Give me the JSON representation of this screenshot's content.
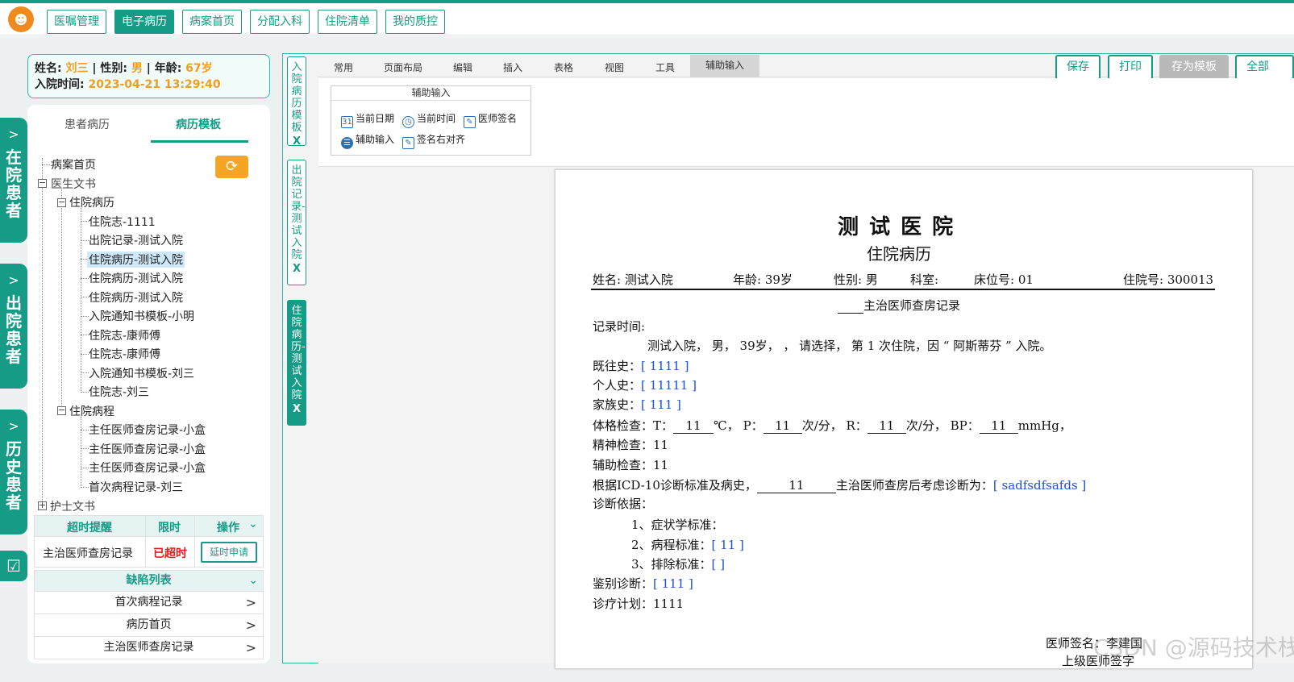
{
  "nav": {
    "tabs": [
      "医嘱管理",
      "电子病历",
      "病案首页",
      "分配入科",
      "住院清单",
      "我的质控"
    ]
  },
  "side": {
    "tabs": [
      "在院患者",
      "出院患者",
      "历史患者"
    ]
  },
  "patient": {
    "name_label": "姓名:",
    "name": "刘三",
    "gender_label": "| 性别:",
    "gender": "男",
    "age_label": "| 年龄:",
    "age": "67岁",
    "admit_label": "入院时间:",
    "admit_time": "2023-04-21 13:29:40"
  },
  "left_tabs": [
    "患者病历",
    "病历模板"
  ],
  "tree": [
    "病案首页",
    "医生文书",
    "住院病历",
    "住院志-1111",
    "出院记录-测试入院",
    "住院病历-测试入院",
    "住院病历-测试入院",
    "住院病历-测试入院",
    "入院通知书模板-小明",
    "住院志-康师傅",
    "住院志-康师傅",
    "入院通知书模板-刘三",
    "住院志-刘三",
    "住院病程",
    "主任医师查房记录-小盒",
    "主任医师查房记录-小盒",
    "主任医师查房记录-小盒",
    "首次病程记录-刘三",
    "护士文书"
  ],
  "alert": {
    "headers": [
      "超时提醒",
      "限时",
      "操作"
    ],
    "row": {
      "name": "主治医师查房记录",
      "status": "已超时",
      "action": "延时申请"
    }
  },
  "defects": {
    "title": "缺陷列表",
    "items": [
      "首次病程记录",
      "病历首页",
      "主治医师查房记录"
    ]
  },
  "vtabs": [
    {
      "label": "入院病历模板",
      "close": "X"
    },
    {
      "label": "出院记录-测试入院",
      "close": "X"
    },
    {
      "label": "住院病历-测试入院",
      "close": "X"
    }
  ],
  "ribbon": {
    "tabs": [
      "常用",
      "页面布局",
      "编辑",
      "插入",
      "表格",
      "视图",
      "工具",
      "辅助输入"
    ],
    "group_title": "辅助输入",
    "items": [
      "当前日期",
      "当前时间",
      "医师签名",
      "辅助输入",
      "签名右对齐"
    ],
    "actions": [
      "保存",
      "打印",
      "存为模板",
      "全部"
    ]
  },
  "document": {
    "hospital": "测 试 医 院",
    "subtitle": "住院病历",
    "name": "姓名: 测试入院",
    "age": "年龄: 39岁",
    "gender": "性别: 男",
    "dept": "科室:",
    "bed": "床位号: 01",
    "inpatient_no": "住院号: 300013",
    "record_title": "主治医师查房记录",
    "record_time": "记录时间:",
    "intro": "测试入院， 男， 39岁， ， 请选择， 第 1 次住院，因 “ 阿斯蒂芬 ” 入院。",
    "past_history_label": "既往史：",
    "past_history": "[ 1111 ]",
    "personal_history_label": "个人史：",
    "personal_history": "[ 11111 ]",
    "family_history_label": "家族史：",
    "family_history": "[ 111 ]",
    "exam_label": "体格检查：",
    "exam_t": "T：",
    "exam_t_val": "11",
    "exam_t_unit": "℃，  P：",
    "exam_p_val": "11",
    "exam_p_unit": "次/分，  R：",
    "exam_r_val": "11",
    "exam_r_unit": "次/分，  BP：",
    "exam_bp_val": "11",
    "exam_bp_unit": "mmHg，",
    "mental": "精神检查：11",
    "aux": "辅助检查：11",
    "basis_pre": "根据ICD-10诊断标准及病史，",
    "basis_val": "11",
    "basis_post": "主治医师查房后考虑诊断为：",
    "basis_diag": "[ sadfsdfsafds ]",
    "diag_basis": "诊断依据：",
    "crit1": "1、症状学标准：",
    "crit2_label": "2、病程标准：",
    "crit2": "[ 11 ]",
    "crit3_label": "3、排除标准：",
    "crit3": "[ ]",
    "differential_label": "鉴别诊断：",
    "differential": "[ 111 ]",
    "plan": "诊疗计划：1111",
    "sign": "医师签名：李建国",
    "sign2": "上级医师签字"
  },
  "watermark": "CSDN @源码技术栈"
}
